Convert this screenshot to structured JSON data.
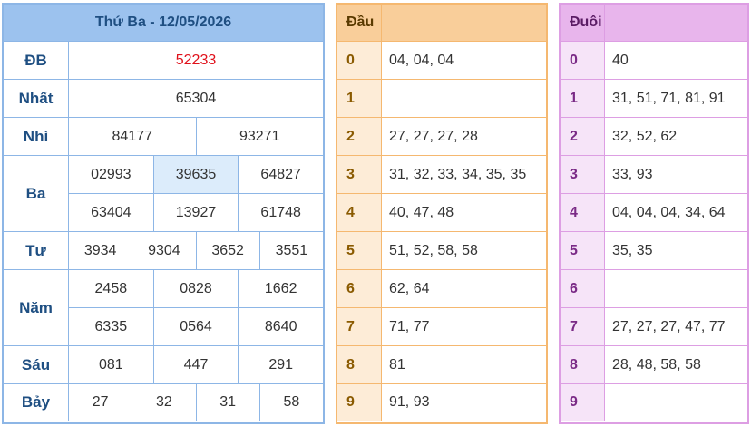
{
  "results": {
    "header": "Thứ Ba - 12/05/2026",
    "rows": [
      {
        "label": "ĐB",
        "lines": [
          [
            "52233"
          ]
        ]
      },
      {
        "label": "Nhất",
        "lines": [
          [
            "65304"
          ]
        ]
      },
      {
        "label": "Nhì",
        "lines": [
          [
            "84177",
            "93271"
          ]
        ]
      },
      {
        "label": "Ba",
        "lines": [
          [
            "02993",
            "39635",
            "64827"
          ],
          [
            "63404",
            "13927",
            "61748"
          ]
        ]
      },
      {
        "label": "Tư",
        "lines": [
          [
            "3934",
            "9304",
            "3652",
            "3551"
          ]
        ]
      },
      {
        "label": "Năm",
        "lines": [
          [
            "2458",
            "0828",
            "1662"
          ],
          [
            "6335",
            "0564",
            "8640"
          ]
        ]
      },
      {
        "label": "Sáu",
        "lines": [
          [
            "081",
            "447",
            "291"
          ]
        ]
      },
      {
        "label": "Bảy",
        "lines": [
          [
            "27",
            "32",
            "31",
            "58"
          ]
        ]
      }
    ]
  },
  "dau": {
    "header": "Đầu",
    "rows": [
      {
        "key": "0",
        "value": "04, 04, 04"
      },
      {
        "key": "1",
        "value": ""
      },
      {
        "key": "2",
        "value": "27, 27, 27, 28"
      },
      {
        "key": "3",
        "value": "31, 32, 33, 34, 35, 35"
      },
      {
        "key": "4",
        "value": "40, 47, 48"
      },
      {
        "key": "5",
        "value": "51, 52, 58, 58"
      },
      {
        "key": "6",
        "value": "62, 64"
      },
      {
        "key": "7",
        "value": "71, 77"
      },
      {
        "key": "8",
        "value": "81"
      },
      {
        "key": "9",
        "value": "91, 93"
      }
    ]
  },
  "duoi": {
    "header": "Đuôi",
    "rows": [
      {
        "key": "0",
        "value": "40"
      },
      {
        "key": "1",
        "value": "31, 51, 71, 81, 91"
      },
      {
        "key": "2",
        "value": "32, 52, 62"
      },
      {
        "key": "3",
        "value": "33, 93"
      },
      {
        "key": "4",
        "value": "04, 04, 04, 34, 64"
      },
      {
        "key": "5",
        "value": "35, 35"
      },
      {
        "key": "6",
        "value": ""
      },
      {
        "key": "7",
        "value": "27, 27, 27, 47, 77"
      },
      {
        "key": "8",
        "value": "28, 48, 58, 58"
      },
      {
        "key": "9",
        "value": ""
      }
    ]
  },
  "colors": {
    "special_prize": "#e0101a",
    "results_border": "#8db6e6",
    "dau_border": "#f5b870",
    "duoi_border": "#dd9ee3"
  }
}
